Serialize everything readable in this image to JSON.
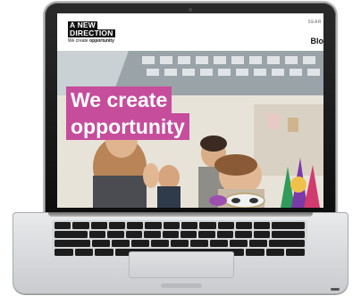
{
  "site": {
    "logo_line1": "A NEW",
    "logo_line2": "DIRECTION",
    "logo_tagline_prefix": "We create ",
    "logo_tagline_bold": "opportunity",
    "nav_search": "SEAR",
    "nav_link": "Blo"
  },
  "hero": {
    "headline_line1": "We create",
    "headline_line2": "opportunity",
    "accent_color": "#c64d9c"
  },
  "icons": {
    "laptop": "laptop-icon"
  }
}
